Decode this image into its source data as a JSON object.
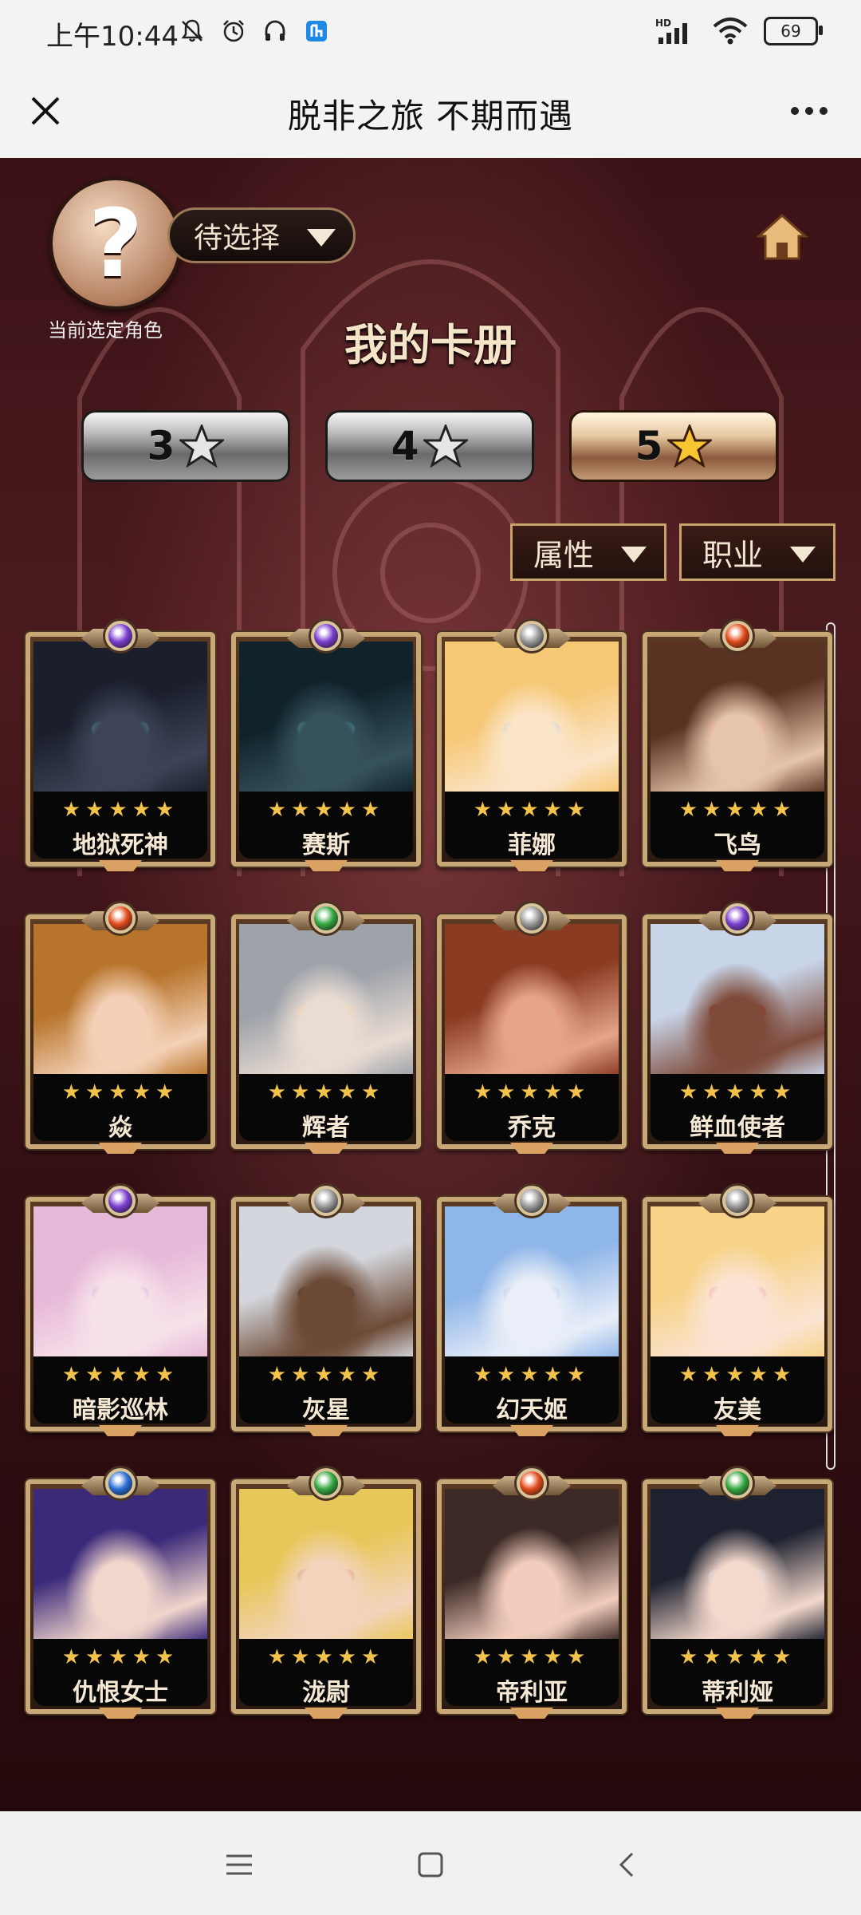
{
  "status_bar": {
    "time": "上午10:44",
    "battery": "69",
    "network": "HD"
  },
  "title_bar": {
    "title": "脱非之旅 不期而遇"
  },
  "game": {
    "avatar_symbol": "?",
    "select_value": "待选择",
    "current_label": "当前选定角色",
    "album_title": "我的卡册",
    "star_tabs": [
      {
        "label": "3",
        "active": false
      },
      {
        "label": "4",
        "active": false
      },
      {
        "label": "5",
        "active": true
      }
    ],
    "filters": {
      "attribute": "属性",
      "profession": "职业"
    },
    "cards": [
      {
        "name": "地狱死神",
        "stars": "★★★★★",
        "gem_color": "#7b3fd0",
        "art": [
          "#1b1f2b",
          "#3d4458",
          "#5ee7ee"
        ]
      },
      {
        "name": "赛斯",
        "stars": "★★★★★",
        "gem_color": "#7b3fd0",
        "art": [
          "#10232a",
          "#36525c",
          "#63f1f4"
        ]
      },
      {
        "name": "菲娜",
        "stars": "★★★★★",
        "gem_color": "#9a9a9a",
        "art": [
          "#f6c774",
          "#fbe5c9",
          "#6aa7e8"
        ]
      },
      {
        "name": "飞鸟",
        "stars": "★★★★★",
        "gem_color": "#e24b1b",
        "art": [
          "#5a3221",
          "#e7c5ac",
          "#c9302c"
        ]
      },
      {
        "name": "焱",
        "stars": "★★★★★",
        "gem_color": "#e24b1b",
        "art": [
          "#b8742c",
          "#f4d1b6",
          "#d05a47"
        ]
      },
      {
        "name": "辉者",
        "stars": "★★★★★",
        "gem_color": "#36a842",
        "art": [
          "#9ea3aa",
          "#e9dcd2",
          "#f2a33a"
        ]
      },
      {
        "name": "乔克",
        "stars": "★★★★★",
        "gem_color": "#9a9a9a",
        "art": [
          "#8a3b22",
          "#e6a58a",
          "#c62d2d"
        ]
      },
      {
        "name": "鲜血使者",
        "stars": "★★★★★",
        "gem_color": "#7b3fd0",
        "art": [
          "#c8d4e8",
          "#7e4b3b",
          "#b3202a"
        ]
      },
      {
        "name": "暗影巡林",
        "stars": "★★★★★",
        "gem_color": "#7b3fd0",
        "art": [
          "#e7b9d8",
          "#f7e2ea",
          "#8b64c8"
        ]
      },
      {
        "name": "灰星",
        "stars": "★★★★★",
        "gem_color": "#9a9a9a",
        "art": [
          "#d3d6dc",
          "#6d4a36",
          "#3c3f46"
        ]
      },
      {
        "name": "幻天姬",
        "stars": "★★★★★",
        "gem_color": "#9a9a9a",
        "art": [
          "#8fb6e9",
          "#e9eef8",
          "#4a76c9"
        ]
      },
      {
        "name": "友美",
        "stars": "★★★★★",
        "gem_color": "#9a9a9a",
        "art": [
          "#f7d38a",
          "#fbe4d4",
          "#e23b5c"
        ]
      },
      {
        "name": "仇恨女士",
        "stars": "★★★★★",
        "gem_color": "#2a6fd6",
        "art": [
          "#3b2a7a",
          "#f1d6cc",
          "#6d4bc9"
        ]
      },
      {
        "name": "泷尉",
        "stars": "★★★★★",
        "gem_color": "#36a842",
        "art": [
          "#e8c75a",
          "#f3d4bd",
          "#b3302a"
        ]
      },
      {
        "name": "帝利亚",
        "stars": "★★★★★",
        "gem_color": "#e24b1b",
        "art": [
          "#3d2a26",
          "#f2cdbd",
          "#9e3b3b"
        ]
      },
      {
        "name": "蒂利娅",
        "stars": "★★★★★",
        "gem_color": "#36a842",
        "art": [
          "#1e2230",
          "#f3d8cc",
          "#4a9fe0"
        ]
      }
    ]
  },
  "nav_bar": {
    "menu_icon": "menu-icon",
    "home_icon": "square-icon",
    "back_icon": "back-icon"
  }
}
